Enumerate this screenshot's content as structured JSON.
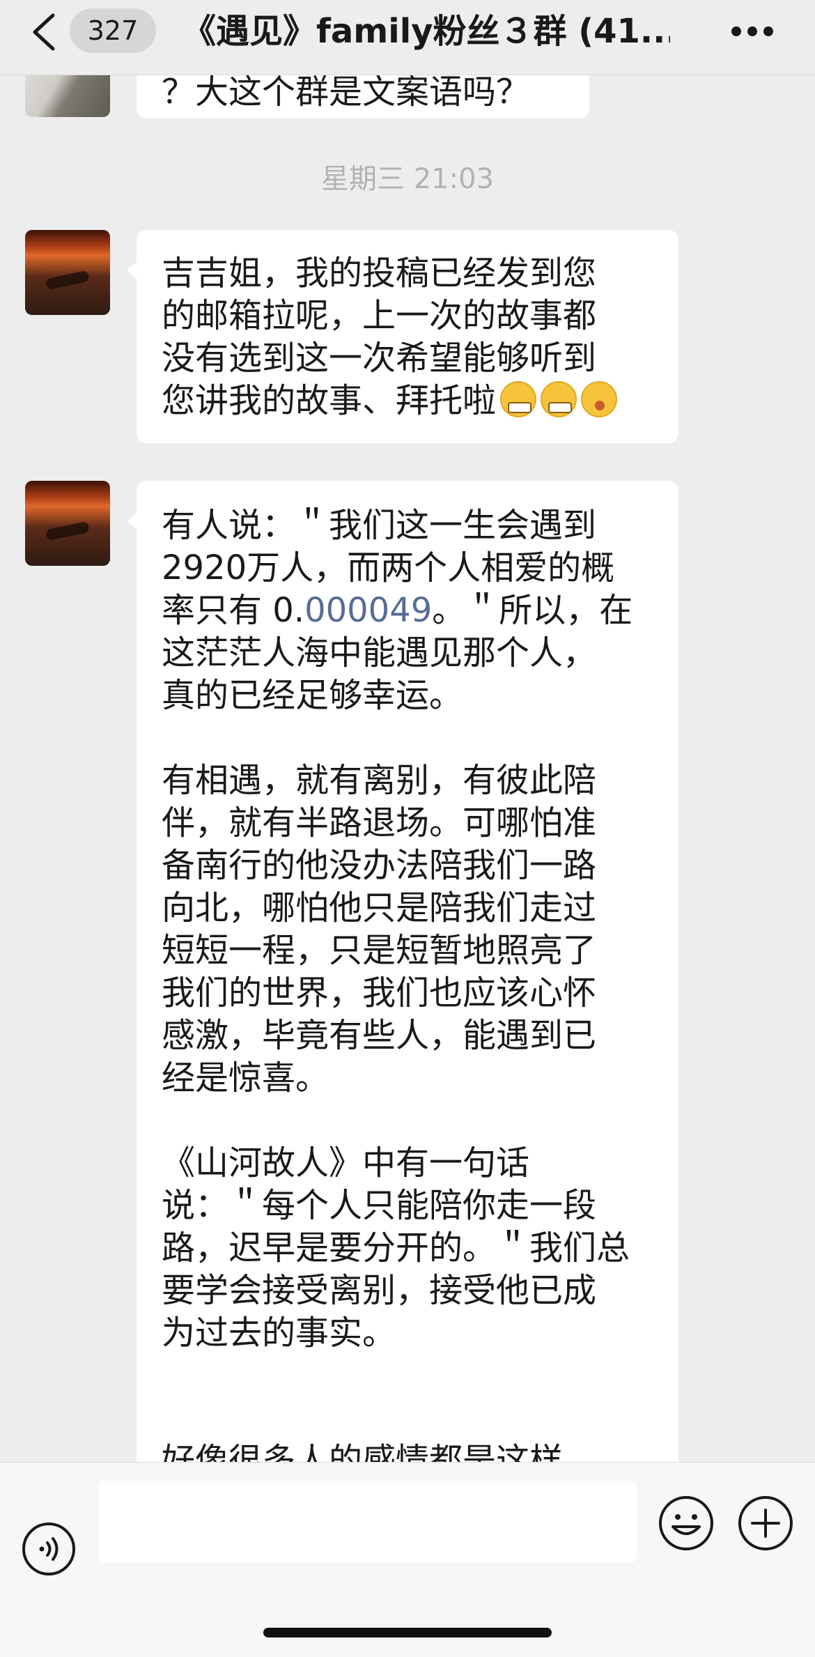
{
  "header": {
    "unread_count": "327",
    "title": "《遇见》family粉丝３群 (41..."
  },
  "messages": [
    {
      "text": "？大这个群是文案语吗？"
    },
    {
      "timestamp": "星期三 21:03"
    },
    {
      "text_lines": [
        "吉吉姐，我的投稿已经发到您",
        "的邮箱拉呢，上一次的故事都",
        "没有选到这一次希望能够听到",
        "您讲我的故事、拜托啦"
      ],
      "emojis": [
        "grimacing-face-icon",
        "grimacing-face-icon",
        "shushing-face-icon"
      ]
    },
    {
      "paragraphs": [
        {
          "lines": [
            "有人说：＂我们这一生会遇到",
            "2920万人，而两个人相爱的概"
          ],
          "line3_prefix": "率只有 0.",
          "link_number": "000049",
          "line3_suffix": "。＂所以，在",
          "more_lines": [
            "这茫茫人海中能遇见那个人，",
            "真的已经足够幸运。"
          ]
        },
        {
          "lines": [
            "有相遇，就有离别，有彼此陪",
            "伴，就有半路退场。可哪怕准",
            "备南行的他没办法陪我们一路",
            "向北，哪怕他只是陪我们走过",
            "短短一程，只是短暂地照亮了",
            "我们的世界，我们也应该心怀",
            "感激，毕竟有些人，能遇到已",
            "经是惊喜。"
          ]
        },
        {
          "lines": [
            "《山河故人》中有一句话",
            "说：＂每个人只能陪你走一段",
            "路，迟早是要分开的。＂我们总",
            "要学会接受离别，接受他已成",
            "为过去的事实。"
          ]
        },
        {
          "lines": [
            "好像很多人的感情都是这样"
          ]
        }
      ]
    }
  ],
  "input": {
    "placeholder": ""
  },
  "icons": {
    "back": "chevron-left-icon",
    "more": "more-dots-icon",
    "voice": "voice-icon",
    "emoji": "emoji-icon",
    "add": "plus-icon"
  }
}
